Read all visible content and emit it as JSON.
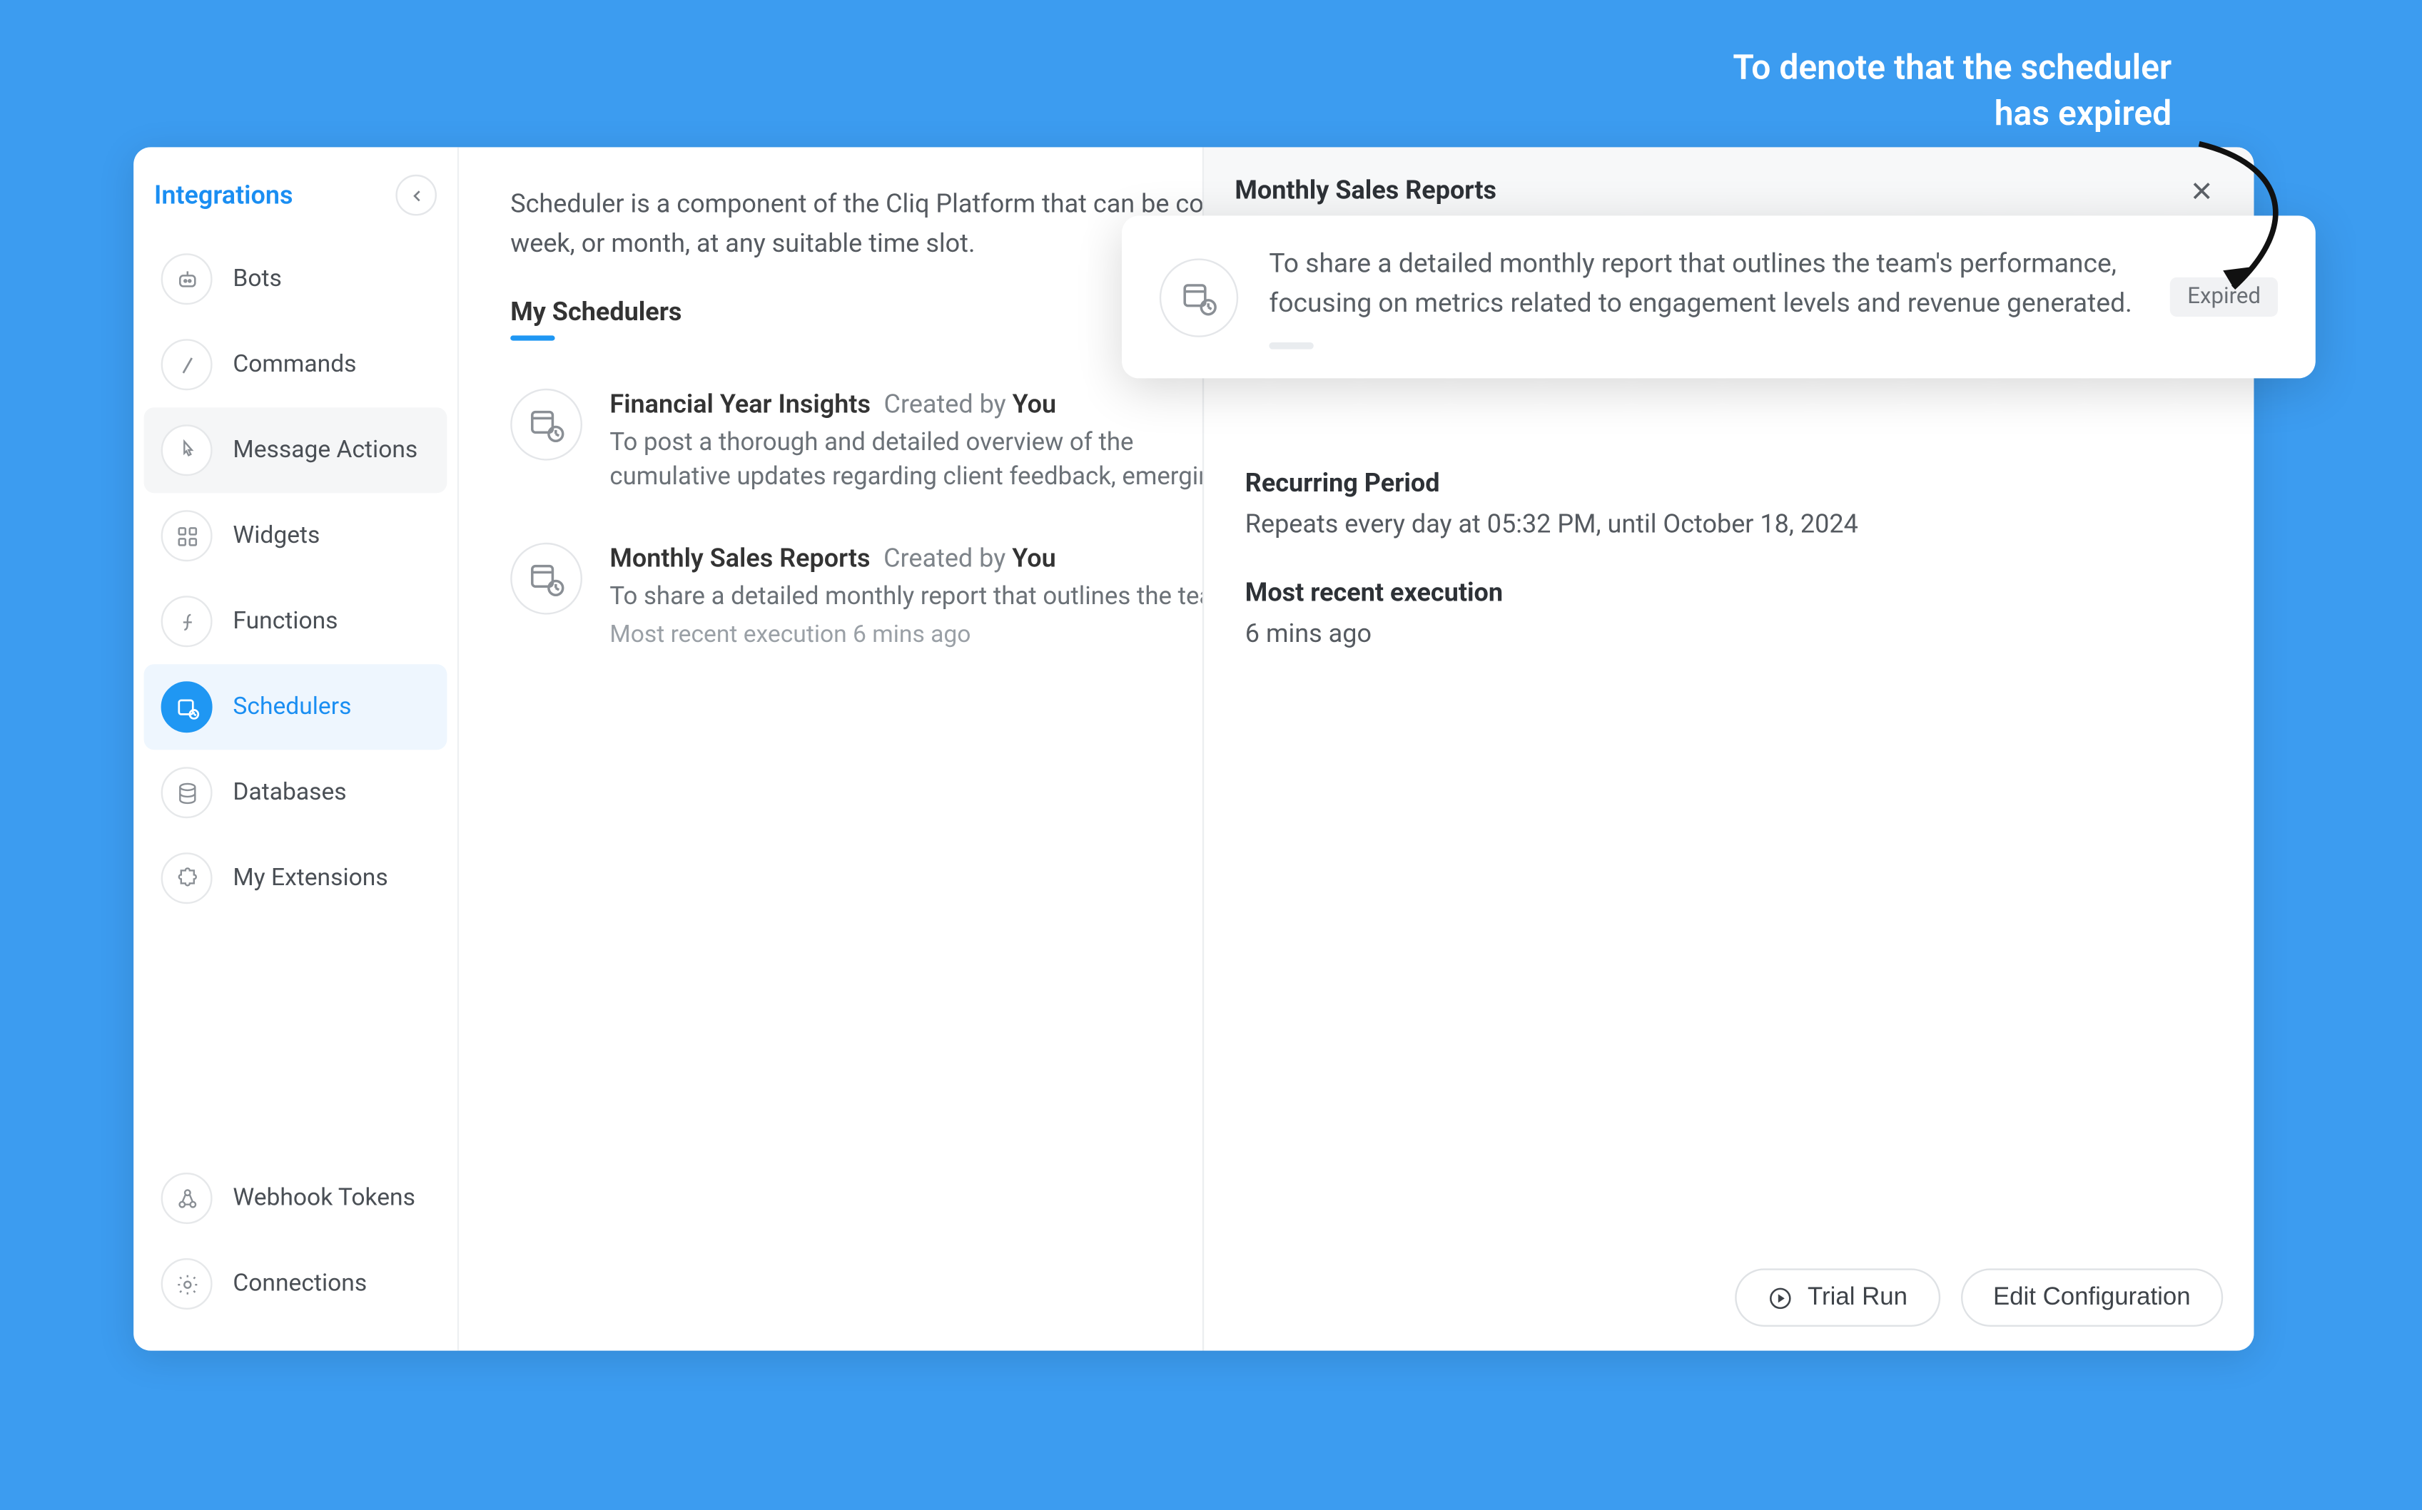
{
  "sidebar": {
    "title": "Integrations",
    "items": [
      {
        "id": "bots",
        "label": "Bots"
      },
      {
        "id": "commands",
        "label": "Commands"
      },
      {
        "id": "message-actions",
        "label": "Message Actions"
      },
      {
        "id": "widgets",
        "label": "Widgets"
      },
      {
        "id": "functions",
        "label": "Functions"
      },
      {
        "id": "schedulers",
        "label": "Schedulers"
      },
      {
        "id": "databases",
        "label": "Databases"
      },
      {
        "id": "my-extensions",
        "label": "My Extensions"
      }
    ],
    "bottom_items": [
      {
        "id": "webhook-tokens",
        "label": "Webhook Tokens"
      },
      {
        "id": "connections",
        "label": "Connections"
      }
    ],
    "active_id": "schedulers",
    "hover_id": "message-actions"
  },
  "main": {
    "intro_lead": "Scheduler is a component of the Cliq Platform that can be configured",
    "intro_tail": "week, or month, at any suitable time slot.",
    "section_title": "My Schedulers",
    "schedulers": [
      {
        "title": "Financial Year Insights",
        "created_by_label": "Created by",
        "created_by_user": "You",
        "description": "To post a thorough and detailed overview of the cumulative updates regarding client feedback, emerging market trends, and any major milestones or transformations."
      },
      {
        "title": "Monthly Sales Reports",
        "created_by_label": "Created by",
        "created_by_user": "You",
        "description": "To share a detailed monthly report that outlines the team's performance, focusing on metrics related to engagement levels and revenue generated.",
        "meta": "Most recent execution 6 mins ago"
      }
    ]
  },
  "detail": {
    "title": "Monthly Sales Reports",
    "summary": "To share a detailed monthly report that outlines the team's performance, focusing on metrics related to engagement levels and revenue generated.",
    "status_badge": "Expired",
    "recurring_label": "Recurring Period",
    "recurring_value": "Repeats every day at 05:32 PM, until October 18, 2024",
    "recent_label": "Most recent execution",
    "recent_value": "6 mins ago",
    "buttons": {
      "trial_run": "Trial Run",
      "edit_config": "Edit Configuration"
    }
  },
  "annotation": {
    "line1": "To denote that the scheduler",
    "line2": "has expired"
  }
}
